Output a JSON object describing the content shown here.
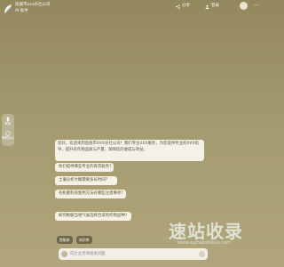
{
  "header": {
    "logo_text_1": "恩施市xxx农社公司",
    "logo_text_2": "AI 助手",
    "share_label": "分享",
    "login_label": "登录",
    "more_label": "···"
  },
  "sidebar": {
    "items": [
      {
        "label": "联系"
      },
      {
        "label": "帮助中心"
      }
    ]
  },
  "chat": {
    "greeting": "您好，欢迎来到恩施市XXX农社公司！我们专注XXX服务，为您提供专业的XXX指导，提升农作物品质与产量，保障您的收成与效益。",
    "questions": [
      "你们提供哪些专业的育苗服务？",
      "土壤分析大概需要多长时间？",
      "有机肥料的使用方法有哪些注意事项？",
      "如何根据当地气候选择合适的作物品种？"
    ]
  },
  "tools": {
    "chip_1": "智能体",
    "chip_2": "知识库"
  },
  "input": {
    "placeholder": "向企业咨询相关问题"
  },
  "watermark": {
    "text": "速站收录",
    "url": "www.suzhanshoulu.com"
  },
  "colors": {
    "bg_top": "#93885d",
    "bg_bottom": "#b1a67b"
  }
}
